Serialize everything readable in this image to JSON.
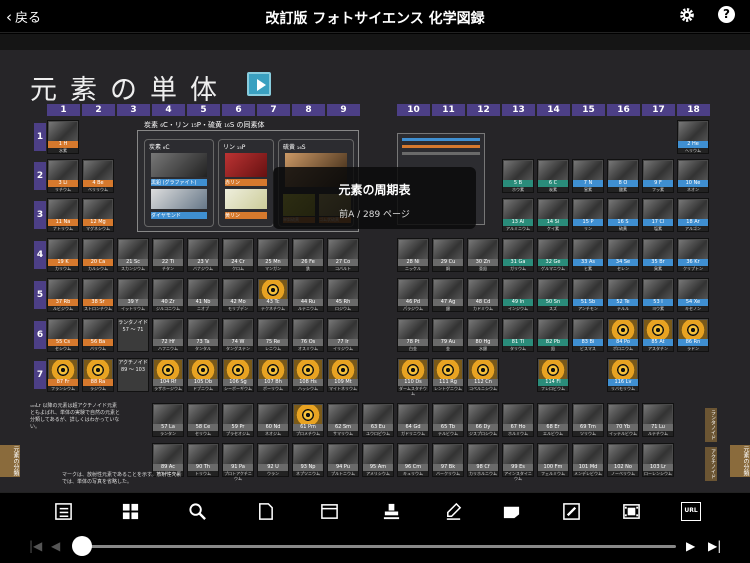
{
  "header": {
    "back_label": "戻る",
    "title": "改訂版 フォトサイエンス 化学図録"
  },
  "page": {
    "title": "元素の単体"
  },
  "groups": [
    "1",
    "2",
    "3",
    "4",
    "5",
    "6",
    "7",
    "8",
    "9",
    "10",
    "11",
    "12",
    "13",
    "14",
    "15",
    "16",
    "17",
    "18"
  ],
  "periods": [
    "1",
    "2",
    "3",
    "4",
    "5",
    "6",
    "7"
  ],
  "overlay": {
    "title": "元素の周期表",
    "page_info": "前A / 289 ページ"
  },
  "infobox": {
    "heading": "炭素 ₆C・リン ₁₅P・硫黄 ₁₆S の同素体",
    "carbon": "炭素 ₆C",
    "phosphorus": "リン ₁₅P",
    "sulfur": "硫黄 ₁₆S",
    "items": [
      "黒鉛 (グラファイト)",
      "赤リン",
      "ダイヤモンド",
      "黄リン",
      "単斜硫黄",
      "ゴム状硫黄"
    ]
  },
  "notes": {
    "n1": "₁₀₃Lr 以降の元素は超アクチノイド元素ともよばれ、単体の実験で自然の元素と分類してあるが、詳しくはわかっていない。",
    "n2": "マークは、放射性元素であることを示す。放射性元素では、単体の写真を省略した。"
  },
  "side": {
    "left": "元素の分類",
    "right": "元素の分類"
  },
  "series": {
    "lanthanoid": "ランタノイド",
    "actinoid": "アクチノイド",
    "lan_range": "57 ～ 71",
    "act_range": "89 ～ 103"
  },
  "toolbar_icons": [
    "list-icon",
    "grid-icon",
    "search-icon",
    "page-icon",
    "bookmark-window-icon",
    "stamp-icon",
    "pen-icon",
    "sticky-note-icon",
    "edit-icon",
    "film-icon",
    "url-icon"
  ],
  "toolbar_url_label": "URL",
  "elements": {
    "p1": [
      {
        "s": "H",
        "n": "1",
        "j": "水素",
        "g": 1
      },
      {
        "s": "He",
        "n": "2",
        "j": "ヘリウム",
        "g": 18
      }
    ],
    "p2": [
      {
        "s": "Li",
        "n": "3",
        "j": "リチウム",
        "g": 1
      },
      {
        "s": "Be",
        "n": "4",
        "j": "ベリリウム",
        "g": 2
      },
      {
        "s": "B",
        "n": "5",
        "j": "ホウ素",
        "g": 13
      },
      {
        "s": "C",
        "n": "6",
        "j": "炭素",
        "g": 14
      },
      {
        "s": "N",
        "n": "7",
        "j": "窒素",
        "g": 15
      },
      {
        "s": "O",
        "n": "8",
        "j": "酸素",
        "g": 16
      },
      {
        "s": "F",
        "n": "9",
        "j": "フッ素",
        "g": 17
      },
      {
        "s": "Ne",
        "n": "10",
        "j": "ネオン",
        "g": 18
      }
    ],
    "p3": [
      {
        "s": "Na",
        "n": "11",
        "j": "ナトリウム",
        "g": 1
      },
      {
        "s": "Mg",
        "n": "12",
        "j": "マグネシウム",
        "g": 2
      },
      {
        "s": "Al",
        "n": "13",
        "j": "アルミニウム",
        "g": 13
      },
      {
        "s": "Si",
        "n": "14",
        "j": "ケイ素",
        "g": 14
      },
      {
        "s": "P",
        "n": "15",
        "j": "リン",
        "g": 15
      },
      {
        "s": "S",
        "n": "16",
        "j": "硫黄",
        "g": 16
      },
      {
        "s": "Cl",
        "n": "17",
        "j": "塩素",
        "g": 17
      },
      {
        "s": "Ar",
        "n": "18",
        "j": "アルゴン",
        "g": 18
      }
    ],
    "p4": [
      {
        "s": "K",
        "n": "19",
        "j": "カリウム",
        "g": 1
      },
      {
        "s": "Ca",
        "n": "20",
        "j": "カルシウム",
        "g": 2
      },
      {
        "s": "Sc",
        "n": "21",
        "j": "スカンジウム",
        "g": 3
      },
      {
        "s": "Ti",
        "n": "22",
        "j": "チタン",
        "g": 4
      },
      {
        "s": "V",
        "n": "23",
        "j": "バナジウム",
        "g": 5
      },
      {
        "s": "Cr",
        "n": "24",
        "j": "クロム",
        "g": 6
      },
      {
        "s": "Mn",
        "n": "25",
        "j": "マンガン",
        "g": 7
      },
      {
        "s": "Fe",
        "n": "26",
        "j": "鉄",
        "g": 8
      },
      {
        "s": "Co",
        "n": "27",
        "j": "コバルト",
        "g": 9
      },
      {
        "s": "Ni",
        "n": "28",
        "j": "ニッケル",
        "g": 10
      },
      {
        "s": "Cu",
        "n": "29",
        "j": "銅",
        "g": 11
      },
      {
        "s": "Zn",
        "n": "30",
        "j": "亜鉛",
        "g": 12
      },
      {
        "s": "Ga",
        "n": "31",
        "j": "ガリウム",
        "g": 13
      },
      {
        "s": "Ge",
        "n": "32",
        "j": "ゲルマニウム",
        "g": 14
      },
      {
        "s": "As",
        "n": "33",
        "j": "ヒ素",
        "g": 15
      },
      {
        "s": "Se",
        "n": "34",
        "j": "セレン",
        "g": 16
      },
      {
        "s": "Br",
        "n": "35",
        "j": "臭素",
        "g": 17
      },
      {
        "s": "Kr",
        "n": "36",
        "j": "クリプトン",
        "g": 18
      }
    ],
    "p5": [
      {
        "s": "Rb",
        "n": "37",
        "j": "ルビジウム",
        "g": 1
      },
      {
        "s": "Sr",
        "n": "38",
        "j": "ストロンチウム",
        "g": 2
      },
      {
        "s": "Y",
        "n": "39",
        "j": "イットリウム",
        "g": 3
      },
      {
        "s": "Zr",
        "n": "40",
        "j": "ジルコニウム",
        "g": 4
      },
      {
        "s": "Nb",
        "n": "41",
        "j": "ニオブ",
        "g": 5
      },
      {
        "s": "Mo",
        "n": "42",
        "j": "モリブデン",
        "g": 6
      },
      {
        "s": "Tc",
        "n": "43",
        "j": "テクネチウム",
        "g": 7,
        "r": 1
      },
      {
        "s": "Ru",
        "n": "44",
        "j": "ルテニウム",
        "g": 8
      },
      {
        "s": "Rh",
        "n": "45",
        "j": "ロジウム",
        "g": 9
      },
      {
        "s": "Pd",
        "n": "46",
        "j": "パラジウム",
        "g": 10
      },
      {
        "s": "Ag",
        "n": "47",
        "j": "銀",
        "g": 11
      },
      {
        "s": "Cd",
        "n": "48",
        "j": "カドミウム",
        "g": 12
      },
      {
        "s": "In",
        "n": "49",
        "j": "インジウム",
        "g": 13
      },
      {
        "s": "Sn",
        "n": "50",
        "j": "スズ",
        "g": 14
      },
      {
        "s": "Sb",
        "n": "51",
        "j": "アンチモン",
        "g": 15
      },
      {
        "s": "Te",
        "n": "52",
        "j": "テルル",
        "g": 16
      },
      {
        "s": "I",
        "n": "53",
        "j": "ヨウ素",
        "g": 17
      },
      {
        "s": "Xe",
        "n": "54",
        "j": "キセノン",
        "g": 18
      }
    ],
    "p6": [
      {
        "s": "Cs",
        "n": "55",
        "j": "セシウム",
        "g": 1
      },
      {
        "s": "Ba",
        "n": "56",
        "j": "バリウム",
        "g": 2
      },
      {
        "s": "Hf",
        "n": "72",
        "j": "ハフニウム",
        "g": 4
      },
      {
        "s": "Ta",
        "n": "73",
        "j": "タンタル",
        "g": 5
      },
      {
        "s": "W",
        "n": "74",
        "j": "タングステン",
        "g": 6
      },
      {
        "s": "Re",
        "n": "75",
        "j": "レニウム",
        "g": 7
      },
      {
        "s": "Os",
        "n": "76",
        "j": "オスミウム",
        "g": 8
      },
      {
        "s": "Ir",
        "n": "77",
        "j": "イリジウム",
        "g": 9
      },
      {
        "s": "Pt",
        "n": "78",
        "j": "白金",
        "g": 10
      },
      {
        "s": "Au",
        "n": "79",
        "j": "金",
        "g": 11
      },
      {
        "s": "Hg",
        "n": "80",
        "j": "水銀",
        "g": 12
      },
      {
        "s": "Tl",
        "n": "81",
        "j": "タリウム",
        "g": 13
      },
      {
        "s": "Pb",
        "n": "82",
        "j": "鉛",
        "g": 14
      },
      {
        "s": "Bi",
        "n": "83",
        "j": "ビスマス",
        "g": 15
      },
      {
        "s": "Po",
        "n": "84",
        "j": "ポロニウム",
        "g": 16,
        "r": 1
      },
      {
        "s": "At",
        "n": "85",
        "j": "アスタチン",
        "g": 17,
        "r": 1
      },
      {
        "s": "Rn",
        "n": "86",
        "j": "ラドン",
        "g": 18,
        "r": 1
      }
    ],
    "p7": [
      {
        "s": "Fr",
        "n": "87",
        "j": "フランシウム",
        "g": 1,
        "r": 1
      },
      {
        "s": "Ra",
        "n": "88",
        "j": "ラジウム",
        "g": 2,
        "r": 1
      },
      {
        "s": "Rf",
        "n": "104",
        "j": "ラザホージウム",
        "g": 4,
        "r": 1
      },
      {
        "s": "Db",
        "n": "105",
        "j": "ドブニウム",
        "g": 5,
        "r": 1
      },
      {
        "s": "Sg",
        "n": "106",
        "j": "シーボーギウム",
        "g": 6,
        "r": 1
      },
      {
        "s": "Bh",
        "n": "107",
        "j": "ボーリウム",
        "g": 7,
        "r": 1
      },
      {
        "s": "Hs",
        "n": "108",
        "j": "ハッシウム",
        "g": 8,
        "r": 1
      },
      {
        "s": "Mt",
        "n": "109",
        "j": "マイトネリウム",
        "g": 9,
        "r": 1
      },
      {
        "s": "Ds",
        "n": "110",
        "j": "ダームスタチウム",
        "g": 10,
        "r": 1
      },
      {
        "s": "Rg",
        "n": "111",
        "j": "レントゲニウム",
        "g": 11,
        "r": 1
      },
      {
        "s": "Cn",
        "n": "112",
        "j": "コペルニシウム",
        "g": 12,
        "r": 1
      },
      {
        "s": "Fl",
        "n": "114",
        "j": "フレロビウム",
        "g": 14,
        "r": 1
      },
      {
        "s": "Lv",
        "n": "116",
        "j": "リバモリウム",
        "g": 16,
        "r": 1
      }
    ],
    "lan": [
      {
        "s": "La",
        "n": "57",
        "j": "ランタン"
      },
      {
        "s": "Ce",
        "n": "58",
        "j": "セリウム"
      },
      {
        "s": "Pr",
        "n": "59",
        "j": "プラセオジム"
      },
      {
        "s": "Nd",
        "n": "60",
        "j": "ネオジム"
      },
      {
        "s": "Pm",
        "n": "61",
        "j": "プロメチウム",
        "r": 1
      },
      {
        "s": "Sm",
        "n": "62",
        "j": "サマリウム"
      },
      {
        "s": "Eu",
        "n": "63",
        "j": "ユウロピウム"
      },
      {
        "s": "Gd",
        "n": "64",
        "j": "ガドリニウム"
      },
      {
        "s": "Tb",
        "n": "65",
        "j": "テルビウム"
      },
      {
        "s": "Dy",
        "n": "66",
        "j": "ジスプロシウム"
      },
      {
        "s": "Ho",
        "n": "67",
        "j": "ホルミウム"
      },
      {
        "s": "Er",
        "n": "68",
        "j": "エルビウム"
      },
      {
        "s": "Tm",
        "n": "69",
        "j": "ツリウム"
      },
      {
        "s": "Yb",
        "n": "70",
        "j": "イッテルビウム"
      },
      {
        "s": "Lu",
        "n": "71",
        "j": "ルテチウム"
      }
    ],
    "act": [
      {
        "s": "Ac",
        "n": "89",
        "j": "アクチニウム"
      },
      {
        "s": "Th",
        "n": "90",
        "j": "トリウム"
      },
      {
        "s": "Pa",
        "n": "91",
        "j": "プロトアクチニウム"
      },
      {
        "s": "U",
        "n": "92",
        "j": "ウラン"
      },
      {
        "s": "Np",
        "n": "93",
        "j": "ネプツニウム"
      },
      {
        "s": "Pu",
        "n": "94",
        "j": "プルトニウム"
      },
      {
        "s": "Am",
        "n": "95",
        "j": "アメリシウム"
      },
      {
        "s": "Cm",
        "n": "96",
        "j": "キュリウム"
      },
      {
        "s": "Bk",
        "n": "97",
        "j": "バークリウム"
      },
      {
        "s": "Cf",
        "n": "98",
        "j": "カリホルニウム"
      },
      {
        "s": "Es",
        "n": "99",
        "j": "アインスタイニウム"
      },
      {
        "s": "Fm",
        "n": "100",
        "j": "フェルミウム"
      },
      {
        "s": "Md",
        "n": "101",
        "j": "メンデレビウム"
      },
      {
        "s": "No",
        "n": "102",
        "j": "ノーベリウム"
      },
      {
        "s": "Lr",
        "n": "103",
        "j": "ローレンシウム"
      }
    ]
  }
}
